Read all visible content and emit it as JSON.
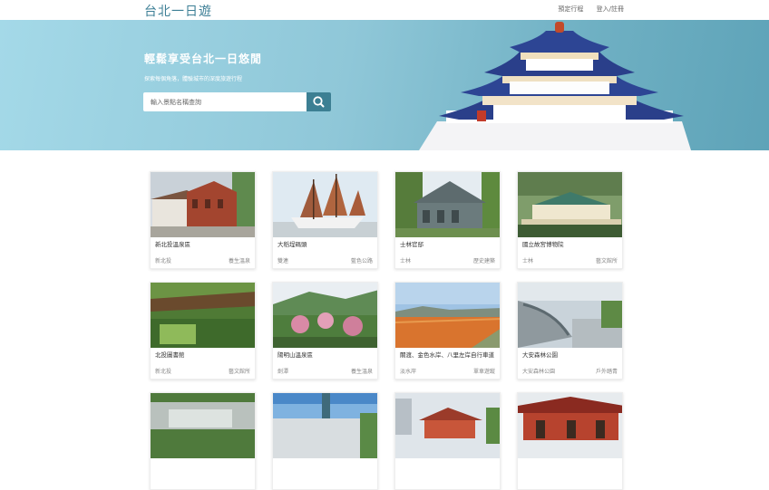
{
  "nav": {
    "brand": "台北一日遊",
    "links": [
      "預定行程",
      "登入/註冊"
    ]
  },
  "hero": {
    "title": "輕鬆享受台北一日悠閒",
    "subtitle": "探索每個角落，體驗城市的深度旅遊行程",
    "search_placeholder": "輸入景點名稱查詢"
  },
  "attractions": [
    {
      "name": "新北投溫泉區",
      "mrt": "新北投",
      "category": "養生溫泉"
    },
    {
      "name": "大稻埕碼頭",
      "mrt": "雙連",
      "category": "藍色公路"
    },
    {
      "name": "士林官邸",
      "mrt": "士林",
      "category": "歷史建築"
    },
    {
      "name": "國立故宮博物院",
      "mrt": "士林",
      "category": "藝文館所"
    },
    {
      "name": "北投圖書館",
      "mrt": "新北投",
      "category": "藝文館所"
    },
    {
      "name": "陽明山溫泉區",
      "mrt": "劍潭",
      "category": "養生溫泉"
    },
    {
      "name": "關渡、金色水岸、八里左岸自行車道",
      "mrt": "淡水岸",
      "category": "單車遊蹤"
    },
    {
      "name": "大安森林公園",
      "mrt": "大安森林公園",
      "category": "戶外踏青"
    },
    {
      "name": "",
      "mrt": "",
      "category": ""
    },
    {
      "name": "",
      "mrt": "",
      "category": ""
    },
    {
      "name": "",
      "mrt": "",
      "category": ""
    },
    {
      "name": "",
      "mrt": "",
      "category": ""
    }
  ],
  "colors": {
    "brand": "#3d7f96",
    "search_button": "#3c7f93",
    "hero_start": "#a4d9e8",
    "hero_end": "#5ea3b8"
  }
}
